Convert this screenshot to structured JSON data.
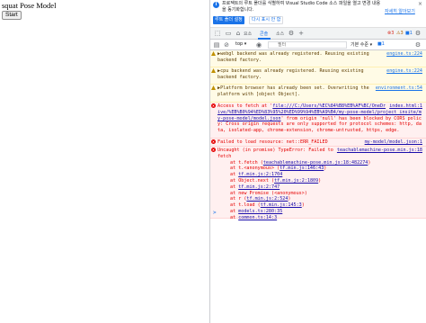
{
  "page": {
    "title": "squat Pose Model",
    "start_label": "Start"
  },
  "banner": {
    "text": "프로젝트의 루트 폴더를 식별하여 Visual Studio Code 소스 파일을 열고 변경 내용을 동기화합니다.",
    "link": "자세히 알아보기",
    "btn_primary": "루트 폴더 설정",
    "btn_secondary": "다시 표시 안 함",
    "close": "×"
  },
  "tabs": [
    {
      "label": "요소"
    },
    {
      "label": "콘솔"
    },
    {
      "label": "소스"
    }
  ],
  "badges": {
    "errors": "3",
    "warnings": "3",
    "messages": "1"
  },
  "toolbar": {
    "context": "top ▾",
    "filter_placeholder": "필터",
    "levels": "기본 수준 ▾",
    "issues": "1"
  },
  "messages": [
    {
      "type": "warn",
      "text": "▶webgl backend was already registered. Reusing existing backend factory.",
      "src": "engine.ts:224"
    },
    {
      "type": "warn",
      "text": "▶cpu backend was already registered. Reusing existing backend factory.",
      "src": "engine.ts:224"
    },
    {
      "type": "warn",
      "text": "▶Platform browser has already been set. Overwriting the platform with [object Object].",
      "src": "environment.ts:54"
    },
    {
      "type": "error",
      "text_before": "Access to fetch at '",
      "link": "file:///C:/Users/%EC%84%B8%EB%AF%BC/OneDrive/%EB%B0%94%ED%83%95%20%ED%99%94%EB%A9%B4/my-pose-model/project_insite/my-pose-model/model.json",
      "text_after": "' from origin 'null' has been blocked by CORS policy: Cross origin requests are only supported for protocol schemes: http, data, isolated-app, chrome-extension, chrome-untrusted, https, edge.",
      "src": "index.html:1"
    },
    {
      "type": "error",
      "text": "Failed to load resource: net::ERR_FAILED",
      "src": "my-model/model.json:1"
    },
    {
      "type": "error",
      "text": "Uncaught (in promise) TypeError: Failed to fetch",
      "src": "teachablemachine-pose.min.js:18",
      "stack": [
        {
          "pre": "at t.fetch (",
          "link": "teachablemachine-pose.min.js:18:482274",
          "post": ")"
        },
        {
          "pre": "at t.<anonymous> (",
          "link": "tf.min.js:146:43",
          "post": ")"
        },
        {
          "pre": "at ",
          "link": "tf.min.js:2:1704",
          "post": ""
        },
        {
          "pre": "at Object.next (",
          "link": "tf.min.js:2:1809",
          "post": ")"
        },
        {
          "pre": "at ",
          "link": "tf.min.js:2:747",
          "post": ""
        },
        {
          "pre": "at new Promise (<anonymous>)",
          "link": "",
          "post": ""
        },
        {
          "pre": "at r (",
          "link": "tf.min.js:2:524",
          "post": ")"
        },
        {
          "pre": "at t.load (",
          "link": "tf.min.js:145:3",
          "post": ")"
        },
        {
          "pre": "at ",
          "link": "models.ts:280:35",
          "post": ""
        },
        {
          "pre": "at ",
          "link": "common.ts:14:3",
          "post": ""
        }
      ]
    }
  ],
  "prompt": ">"
}
